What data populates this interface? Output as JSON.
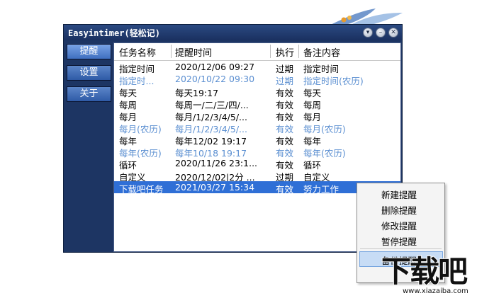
{
  "window": {
    "title": "Easyintimer(轻松记)",
    "sidebar": [
      "提醒",
      "设置",
      "关于"
    ]
  },
  "list": {
    "headers": [
      "任务名称",
      "提醒时间",
      "执行",
      "备注内容"
    ],
    "rows": [
      {
        "name": "指定时间",
        "time": "2020/12/06 09:27",
        "status": "过期",
        "note": "指定时间",
        "style": "normal"
      },
      {
        "name": "指定时...",
        "time": "2020/10/22 09:30",
        "status": "过期",
        "note": "指定时间(农历)",
        "style": "lunar"
      },
      {
        "name": "每天",
        "time": "每天19:17",
        "status": "有效",
        "note": "每天",
        "style": "normal"
      },
      {
        "name": "每周",
        "time": "每周一/二/三/四/...",
        "status": "有效",
        "note": "每周",
        "style": "normal"
      },
      {
        "name": "每月",
        "time": "每月/1/2/3/4/5/...",
        "status": "有效",
        "note": "每月",
        "style": "normal"
      },
      {
        "name": "每月(农历)",
        "time": "每月/1/2/3/4/5/...",
        "status": "有效",
        "note": "每月(农历)",
        "style": "lunar"
      },
      {
        "name": "每年",
        "time": "每年12/02 19:17",
        "status": "有效",
        "note": "每年",
        "style": "normal"
      },
      {
        "name": "每年(农历)",
        "time": "每年10/18 19:17",
        "status": "有效",
        "note": "每年(农历)",
        "style": "lunar"
      },
      {
        "name": "循环",
        "time": "2020/11/26 23:1...",
        "status": "有效",
        "note": "循环",
        "style": "normal"
      },
      {
        "name": "自定义",
        "time": "2020/12/02|2分 ...",
        "status": "过期",
        "note": "自定义",
        "style": "normal"
      },
      {
        "name": "下载吧任务",
        "time": "2021/03/27 15:34",
        "status": "有效",
        "note": "努力工作",
        "style": "selected"
      }
    ]
  },
  "context_menu": [
    "新建提醒",
    "删除提醒",
    "修改提醒",
    "暂停提醒",
    "备份提醒"
  ],
  "watermark": {
    "logo": "下载吧",
    "url": "www.xiazaiba.com"
  },
  "colors": {
    "window_bg": "#1d3563",
    "selected": "#2f6fd6",
    "lunar_text": "#5b8fd1"
  }
}
